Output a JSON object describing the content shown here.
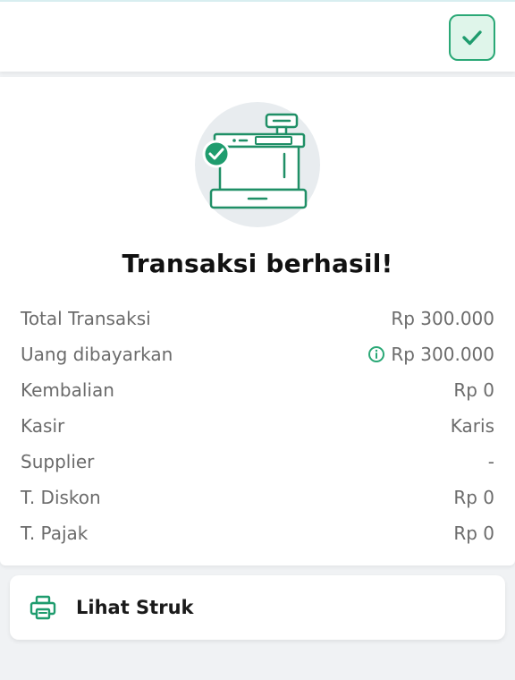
{
  "header": {
    "confirm_icon": "check-icon"
  },
  "illustration": {
    "icon": "cash-register-success-icon",
    "accent": "#1f9c6e",
    "stroke": "#1f8f66",
    "circle_bg": "#e8ecef"
  },
  "result": {
    "title": "Transaksi berhasil!",
    "rows": [
      {
        "label": "Total Transaksi",
        "value": "Rp 300.000"
      },
      {
        "label": "Uang dibayarkan",
        "value": "Rp 300.000",
        "icon": "info-icon"
      },
      {
        "label": "Kembalian",
        "value": "Rp 0"
      },
      {
        "label": "Kasir",
        "value": "Karis"
      },
      {
        "label": "Supplier",
        "value": "-"
      },
      {
        "label": "T. Diskon",
        "value": "Rp 0"
      },
      {
        "label": "T. Pajak",
        "value": "Rp 0"
      }
    ]
  },
  "actions": {
    "receipt_label": "Lihat Struk",
    "receipt_icon": "printer-icon"
  },
  "colors": {
    "brand_green": "#2aa876",
    "text_muted": "#6b6b6b",
    "background": "#f0f2f4"
  }
}
